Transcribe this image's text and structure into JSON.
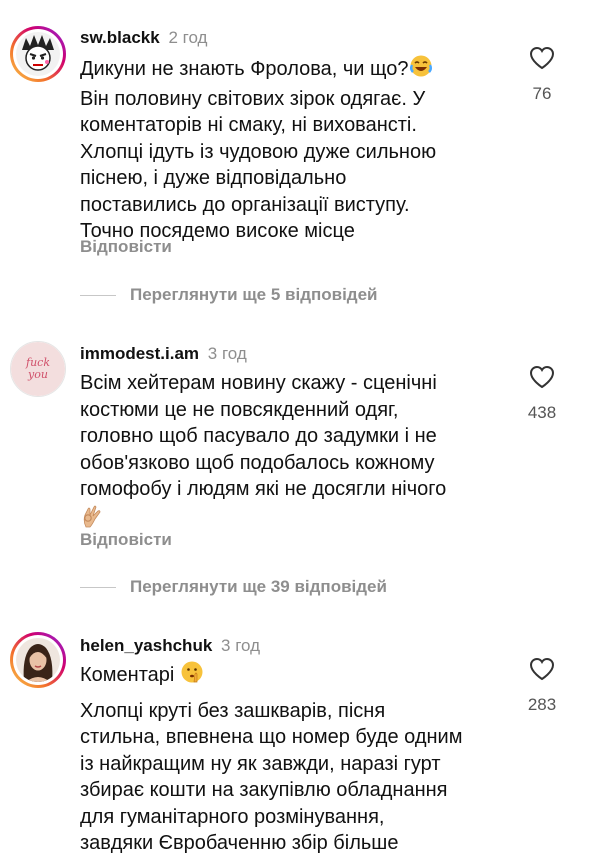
{
  "comments": [
    {
      "username": "sw.blackk",
      "time": "2 год",
      "lines": [
        "Дикуни не знають Фролова, чи що?",
        "Він половину світових зірок одягає. У",
        "коментаторів ні смаку, ні виховансті.",
        "Хлопці ідуть із чудовою дуже сильною",
        "піснею, і дуже відповідально",
        "поставились до організації виступу.",
        "Точно посядемо високе місце"
      ],
      "likes": "76",
      "reply_label": "Відповісти",
      "view_replies": "Переглянути ще 5 відповідей"
    },
    {
      "username": "immodest.i.am",
      "time": "3 год",
      "avatar_text": "fuck you",
      "lines": [
        "Всім хейтерам новину скажу - сценічні",
        "костюми це не повсякденний одяг,",
        "головно щоб пасувало до задумки і не",
        "обов'язково щоб подобалось кожному",
        "гомофобу і людям які не досягли нічого"
      ],
      "likes": "438",
      "reply_label": "Відповісти",
      "view_replies": "Переглянути ще 39 відповідей"
    },
    {
      "username": "helen_yashchuk",
      "time": "3 год",
      "title_line": "Коментарі",
      "lines": [
        "Хлопці круті без зашкварів, пісня",
        "стильна, впевнена що номер буде одним",
        "із найкращим ну як завжди, наразі гурт",
        "збирає кошти на закупівлю обладнання",
        "для гуманітарного розмінування,",
        "завдяки Євробаченню збір більше"
      ],
      "likes": "283"
    }
  ],
  "icons": {
    "heart": "heart-outline-icon",
    "laugh": "face-with-tears-of-joy-icon",
    "ok": "ok-hand-icon",
    "shush": "shushing-face-icon"
  },
  "colors": {
    "muted": "#8e8e8e",
    "text": "#111111",
    "divider": "#c7c7c7"
  }
}
